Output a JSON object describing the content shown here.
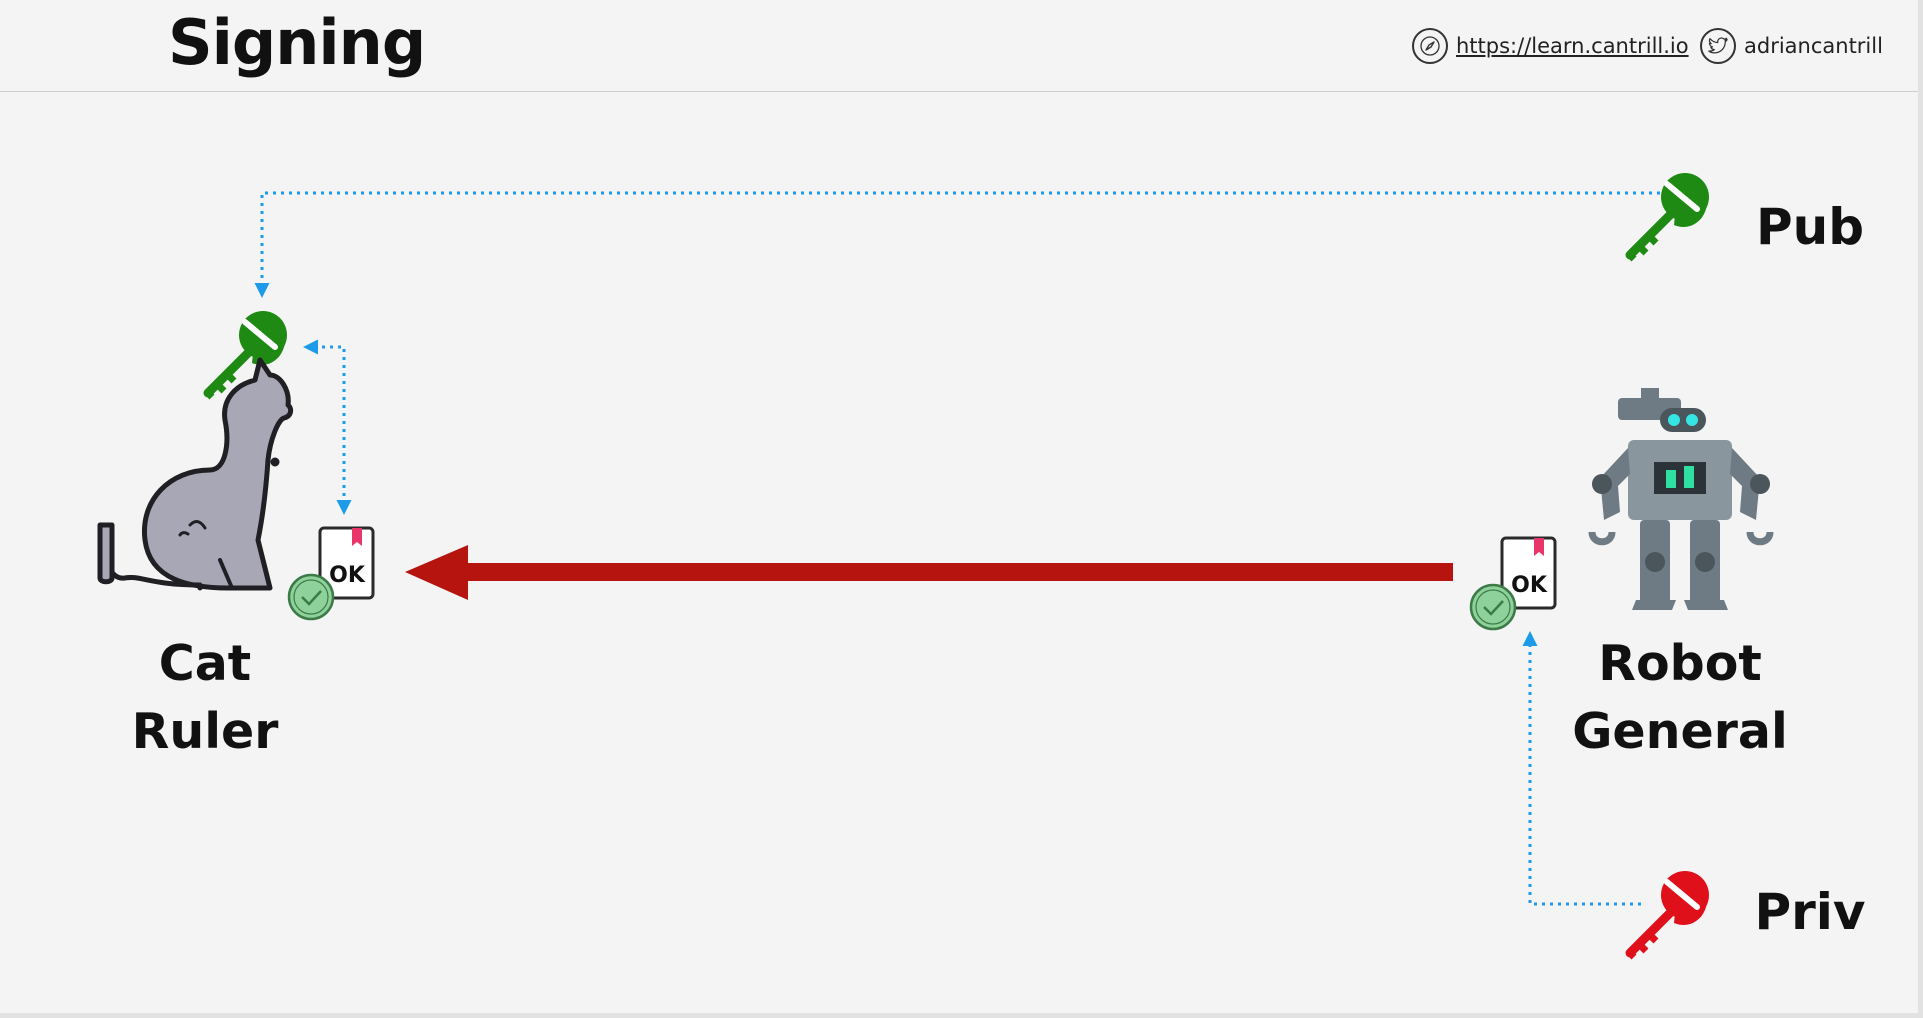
{
  "header": {
    "title": "Signing",
    "website_url": "https://learn.cantrill.io",
    "twitter_handle": "adriancantrill",
    "icons": [
      "compass-icon",
      "twitter-icon"
    ]
  },
  "diagram": {
    "recipient": {
      "line1": "Cat",
      "line2": "Ruler"
    },
    "sender": {
      "line1": "Robot",
      "line2": "General"
    },
    "public_key_label": "Pub",
    "private_key_label": "Priv",
    "document_text": "OK",
    "colors": {
      "public_key": "#1e8a13",
      "private_key": "#e0101a",
      "message_arrow": "#b5140f",
      "dotted_link": "#1e9be8",
      "verified_badge": "#8fd19a",
      "bookmark": "#e8366a"
    }
  }
}
